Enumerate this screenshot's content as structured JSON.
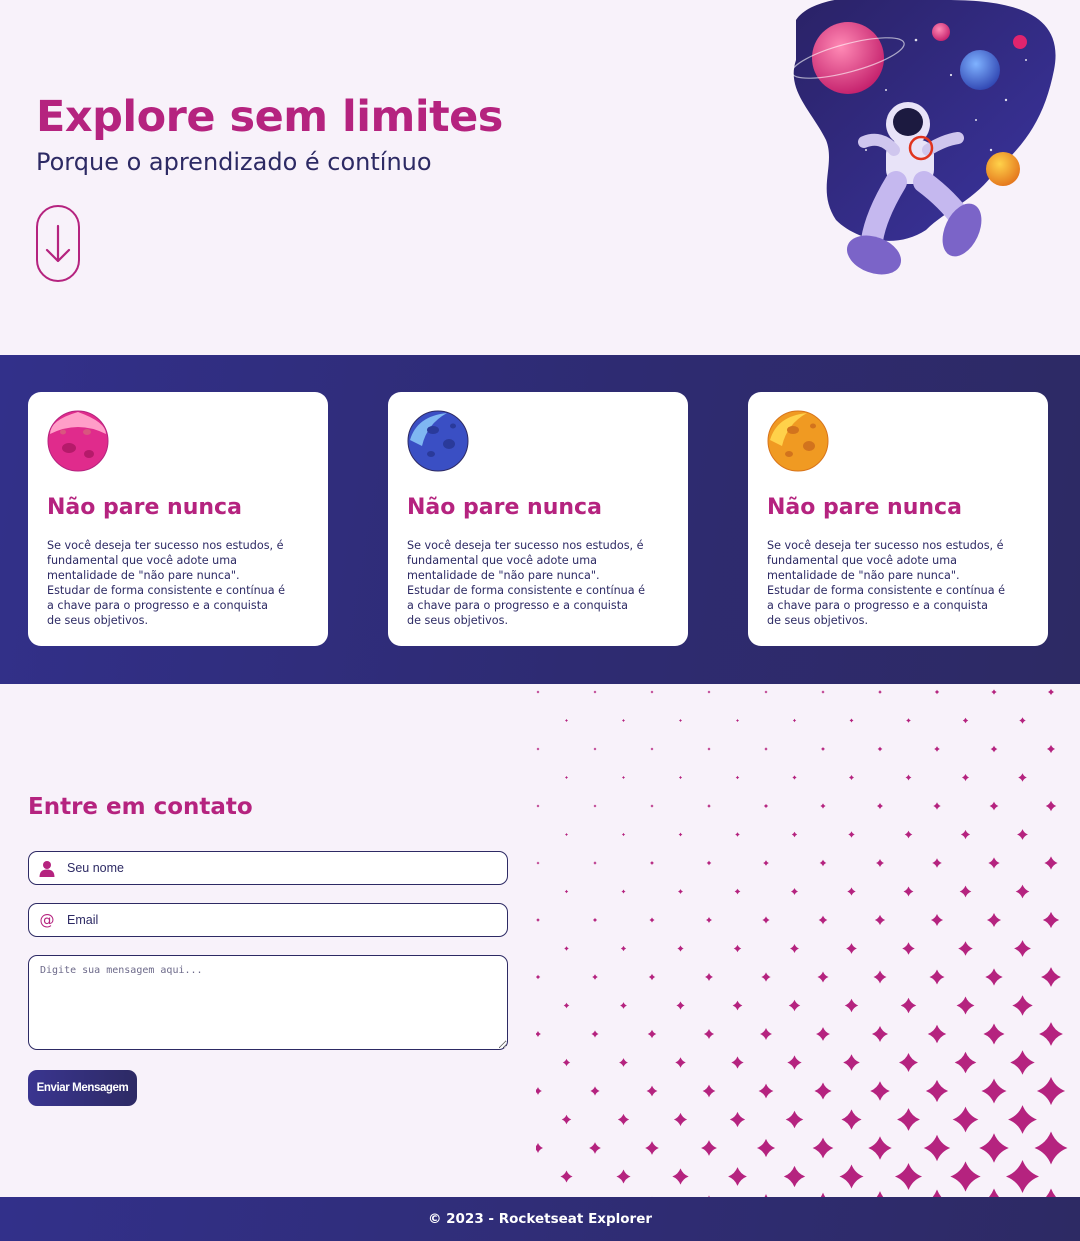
{
  "hero": {
    "title": "Explore sem limites",
    "subtitle": "Porque o aprendizado é contínuo",
    "scroll_icon": "arrow-down-icon",
    "illustration": "astronaut-illustration"
  },
  "cards": [
    {
      "planet": "pink-planet-icon",
      "title": "Não pare nunca",
      "lines": [
        "Se você deseja ter sucesso nos estudos, é",
        "fundamental que você adote uma",
        "mentalidade de \"não pare nunca\".",
        "Estudar de forma consistente e contínua é",
        "a chave para o progresso e a conquista",
        "de seus objetivos."
      ]
    },
    {
      "planet": "blue-planet-icon",
      "title": "Não pare nunca",
      "lines": [
        "Se você deseja ter sucesso nos estudos, é",
        "fundamental que você adote uma",
        "mentalidade de \"não pare nunca\".",
        "Estudar de forma consistente e contínua é",
        "a chave para o progresso e a conquista",
        "de seus objetivos."
      ]
    },
    {
      "planet": "orange-planet-icon",
      "title": "Não pare nunca",
      "lines": [
        "Se você deseja ter sucesso nos estudos, é",
        "fundamental que você adote uma",
        "mentalidade de \"não pare nunca\".",
        "Estudar de forma consistente e contínua é",
        "a chave para o progresso e a conquista",
        "de seus objetivos."
      ]
    }
  ],
  "contact": {
    "title": "Entre em contato",
    "name_placeholder": "Seu nome",
    "name_icon": "user-icon",
    "email_placeholder": "Email",
    "email_icon": "at-sign-icon",
    "message_placeholder": "Digite sua mensagem aqui...",
    "send_label": "Enviar Mensagem"
  },
  "footer": {
    "text": "© 2023 - Rocketseat Explorer"
  },
  "colors": {
    "accent": "#b5237f",
    "primary": "#2d2a64",
    "background": "#f8f2fa"
  }
}
